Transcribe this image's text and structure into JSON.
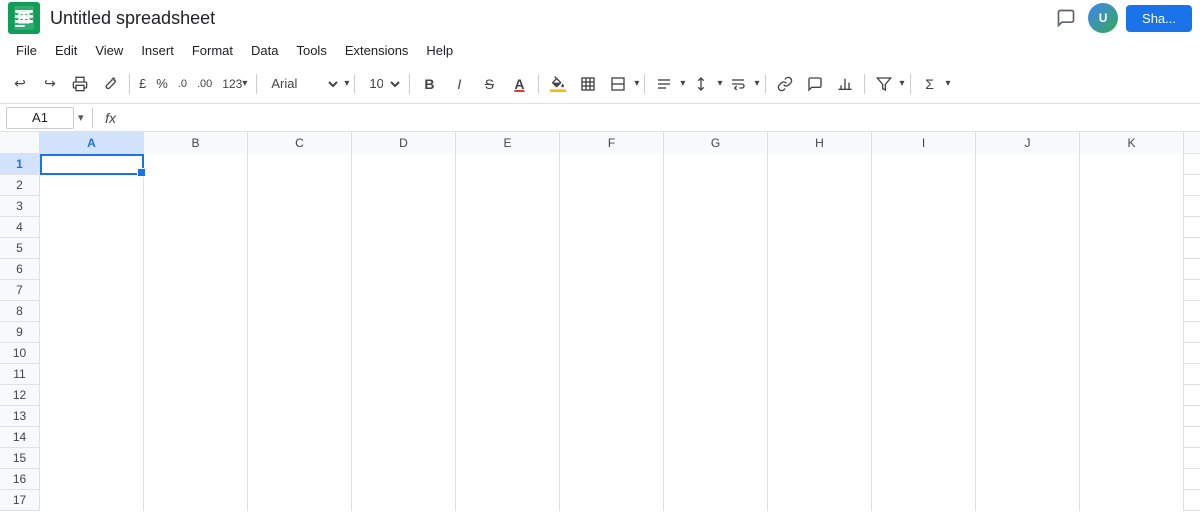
{
  "titleBar": {
    "appName": "Google Sheets",
    "docTitle": "Untitled spreadsheet",
    "shareLabel": "Sha..."
  },
  "menuBar": {
    "items": [
      "File",
      "Edit",
      "View",
      "Insert",
      "Format",
      "Data",
      "Tools",
      "Extensions",
      "Help"
    ]
  },
  "toolbar": {
    "undo": "↩",
    "redo": "↪",
    "print": "🖨",
    "paintFormat": "🎨",
    "currency": "£",
    "percent": "%",
    "decreaseDecimal": ".0",
    "increaseDecimal": ".00",
    "format123": "123",
    "fontName": "Arial",
    "fontSize": "10",
    "bold": "B",
    "italic": "I",
    "strikethrough": "S̶",
    "fontColor": "A",
    "fillColor": "◆",
    "borders": "⊞",
    "merge": "⊟",
    "alignHoriz": "≡",
    "alignVert": "⬍",
    "wrap": "↵",
    "link": "🔗",
    "comment": "💬",
    "chart": "📊",
    "filter": "⊳",
    "functions": "Σ"
  },
  "formulaBar": {
    "cellRef": "A1",
    "fxLabel": "fx",
    "formula": ""
  },
  "grid": {
    "columns": [
      "A",
      "B",
      "C",
      "D",
      "E",
      "F",
      "G",
      "H",
      "I",
      "J",
      "K"
    ],
    "rowCount": 17,
    "selectedCell": "A1"
  }
}
